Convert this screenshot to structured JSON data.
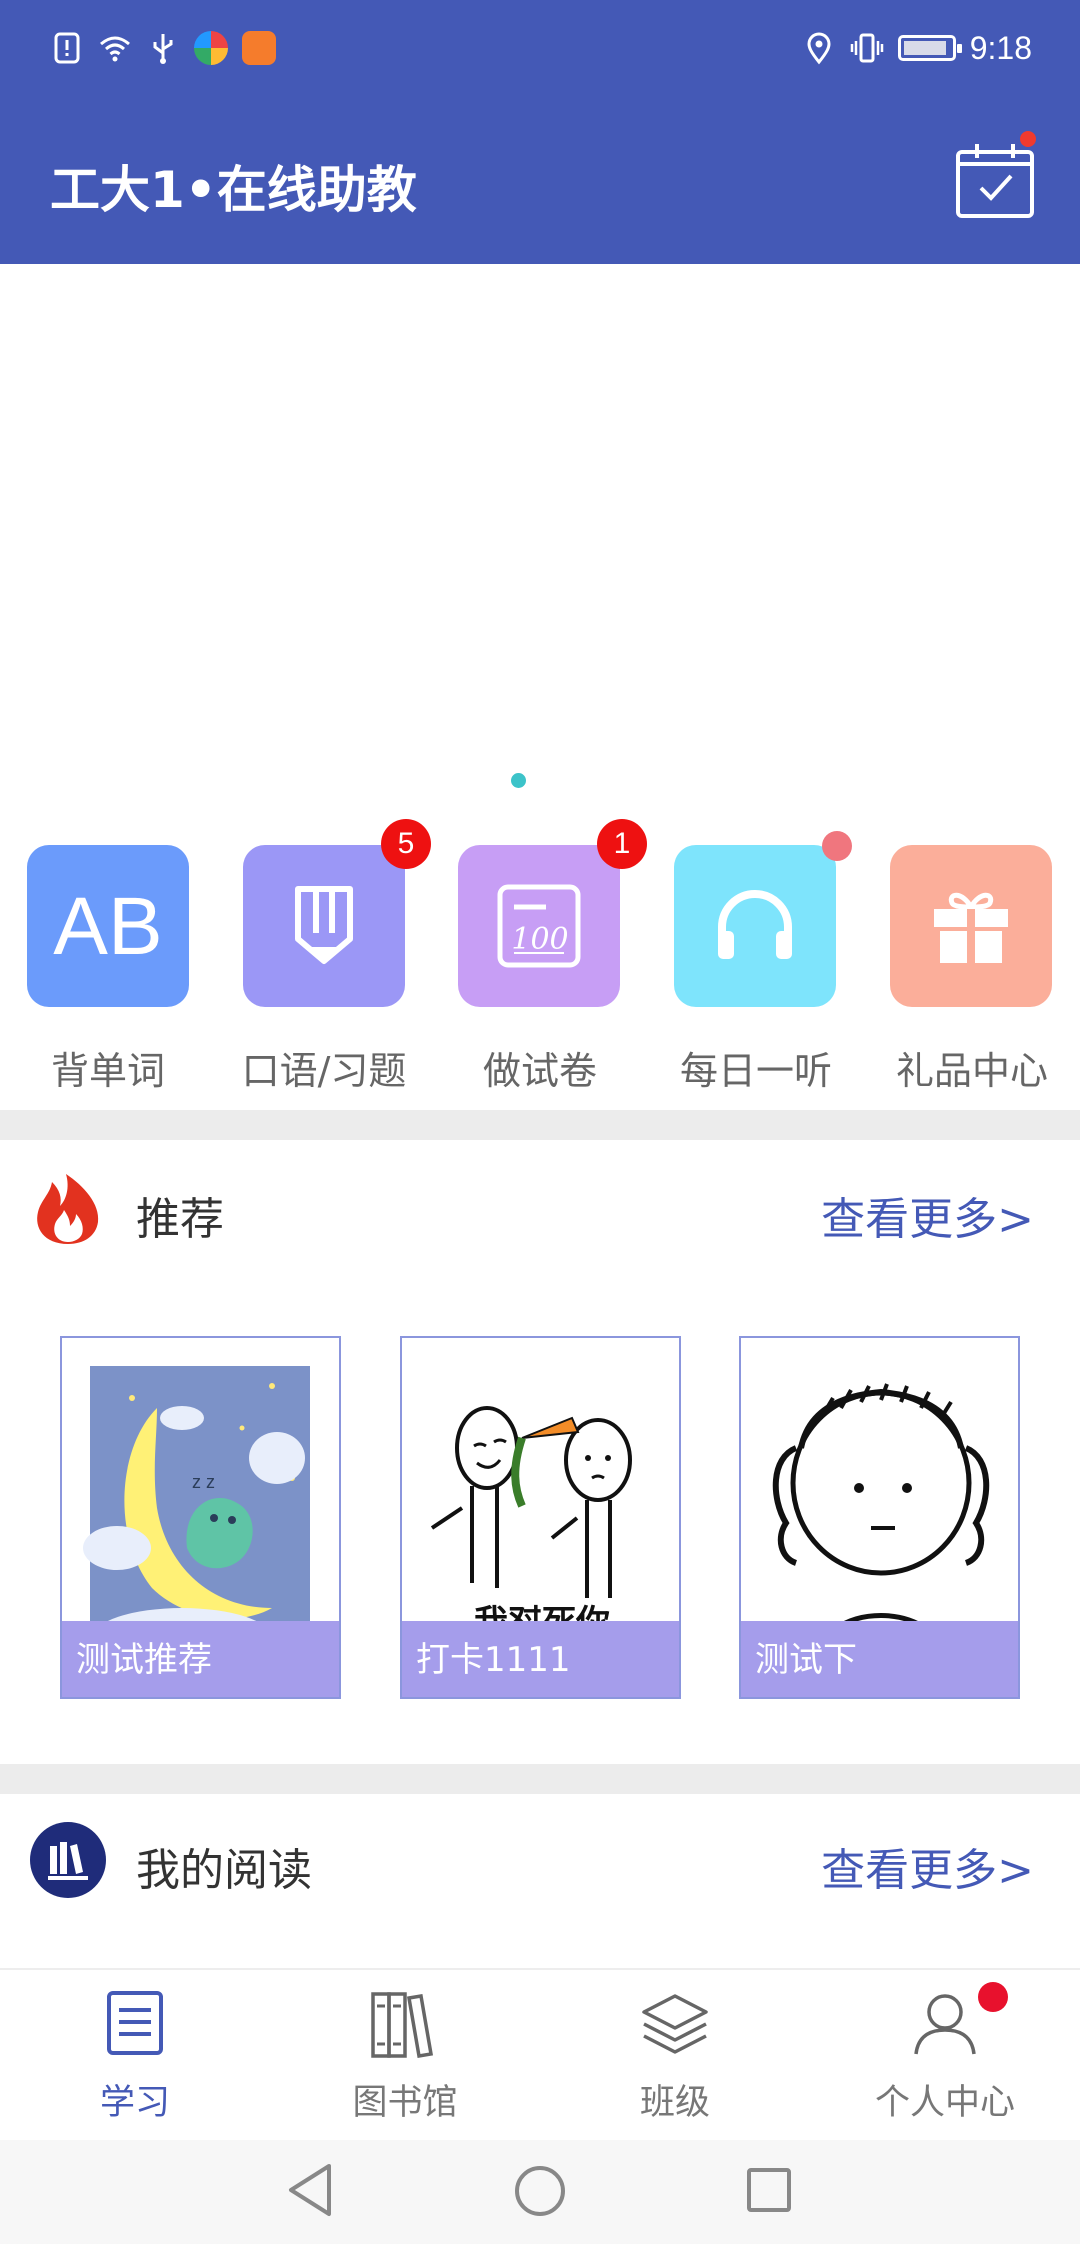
{
  "statusbar": {
    "time": "9:18",
    "left_icons": [
      "alert-icon",
      "wifi-icon",
      "usb-icon",
      "browser-app-icon",
      "uc-app-icon"
    ],
    "right_icons": [
      "location-icon",
      "vibrate-icon",
      "battery-icon"
    ]
  },
  "header": {
    "title": "工大1•在线助教",
    "calendar_icon": "calendar-check-icon",
    "calendar_has_dot": true
  },
  "banner": {
    "pages": 1,
    "active_page": 1,
    "indicator_color": "#3cc3c9"
  },
  "quick_menu": [
    {
      "label": "背单词",
      "icon": "ab-text-icon",
      "color": "#6b9bfb"
    },
    {
      "label": "口语/习题",
      "icon": "pencil-icon",
      "color": "#9b97f6",
      "badge": "5"
    },
    {
      "label": "做试卷",
      "icon": "exam-paper-icon",
      "color": "#c79ef5",
      "badge": "1"
    },
    {
      "label": "每日一听",
      "icon": "headphones-icon",
      "color": "#7ee4fc",
      "dot": true
    },
    {
      "label": "礼品中心",
      "icon": "gift-icon",
      "color": "#fbae9a"
    }
  ],
  "recommend": {
    "title": "推荐",
    "more": "查看更多>",
    "icon": "fire-icon",
    "cards": [
      {
        "label": "测试推荐",
        "image": "dinosaur-moon-illustration"
      },
      {
        "label": "打卡1111",
        "image": "meme-carrot-illustration",
        "image_text": "我怼死你"
      },
      {
        "label": "测试下",
        "image": "meme-face-illustration"
      }
    ]
  },
  "reading": {
    "title": "我的阅读",
    "more": "查看更多>",
    "icon": "books-icon"
  },
  "bottom_nav": [
    {
      "label": "学习",
      "icon": "document-icon",
      "active": true
    },
    {
      "label": "图书馆",
      "icon": "library-icon",
      "active": false
    },
    {
      "label": "班级",
      "icon": "layers-icon",
      "active": false
    },
    {
      "label": "个人中心",
      "icon": "person-icon",
      "active": false,
      "dot": true
    }
  ],
  "colors": {
    "primary": "#4459b6",
    "badge": "#ee1111",
    "card_caption": "#a59deb"
  }
}
